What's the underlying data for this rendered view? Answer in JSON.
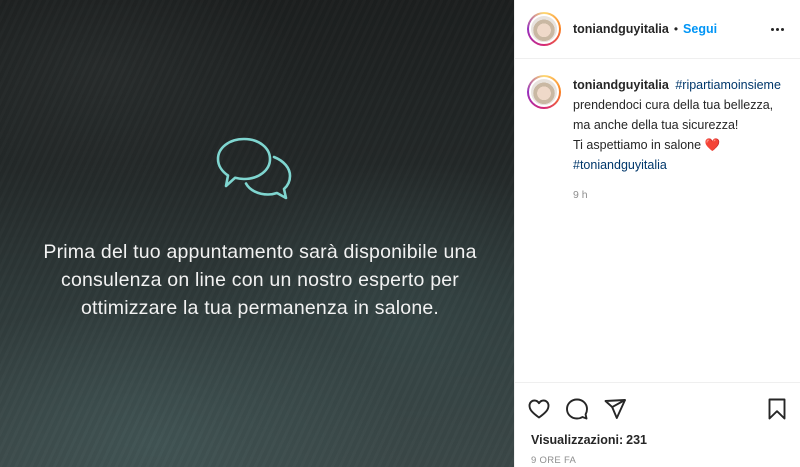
{
  "post": {
    "username": "toniandguyitalia",
    "follow_label": "Segui",
    "header_separator": "•",
    "icons": {
      "more": "more-horizontal-icon",
      "like": "heart-icon",
      "comment": "comment-icon",
      "share": "direct-share-icon",
      "save": "bookmark-icon"
    }
  },
  "media": {
    "text": "Prima del tuo appuntamento sarà disponibile una consulenza on line con un nostro esperto per ottimizzare la tua permanenza in salone.",
    "icon": "speech-bubbles-icon",
    "icon_color": "#7fd6d0"
  },
  "caption": {
    "username": "toniandguyitalia",
    "hashtag1": "#ripartiamoinsieme",
    "line1": "prendendoci cura della tua bellezza,",
    "line2": "ma anche della tua sicurezza!",
    "line3": "Ti aspettiamo in salone",
    "heart": "❤️",
    "hashtag2": "#toniandguyitalia",
    "time": "9 h"
  },
  "footer": {
    "views_label": "Visualizzazioni:",
    "views_count": "231",
    "time_ago": "9 ORE FA"
  },
  "colors": {
    "follow_blue": "#0095f6",
    "hashtag_blue": "#00376b",
    "muted_gray": "#8e8e8e"
  }
}
